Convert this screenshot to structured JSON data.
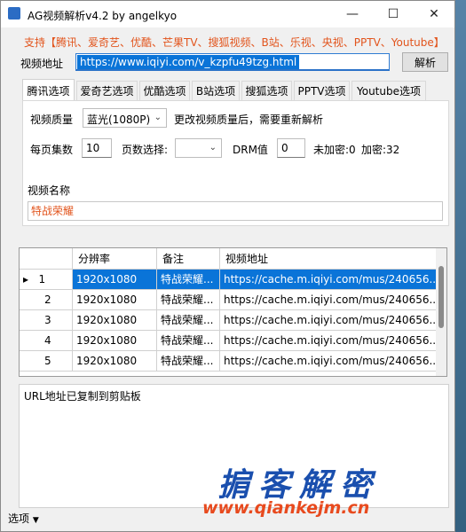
{
  "window": {
    "title": "AG视频解析v4.2 by angelkyo",
    "controls": [
      "minimize-icon",
      "maximize-icon",
      "close-icon"
    ]
  },
  "support_text": "支持【腾讯、爱奇艺、优酷、芒果TV、搜狐视频、B站、乐视、央视、PPTV、Youtube】",
  "url": {
    "label": "视频地址",
    "value": "https://www.iqiyi.com/v_kzpfu49tzg.html"
  },
  "parse_button": "解析",
  "tabs": [
    "腾讯选项",
    "爱奇艺选项",
    "优酷选项",
    "B站选项",
    "搜狐选项",
    "PPTV选项",
    "Youtube选项"
  ],
  "quality": {
    "label": "视频质量",
    "selected": "蓝光(1080P)",
    "hint": "更改视频质量后，需要重新解析"
  },
  "paging": {
    "per_page_label": "每页集数",
    "per_page_value": "10",
    "page_select_label": "页数选择:",
    "page_select_value": "",
    "drm_label": "DRM值",
    "drm_value": "0",
    "unencrypted": "未加密:0",
    "encrypted": "加密:32"
  },
  "video_name": {
    "label": "视频名称",
    "value": "特战荣耀"
  },
  "grid": {
    "columns": [
      "",
      "分辨率",
      "备注",
      "视频地址"
    ],
    "rows": [
      {
        "num": "1",
        "resolution": "1920x1080",
        "note": "特战荣耀...",
        "url": "https://cache.m.iqiyi.com/mus/240656..."
      },
      {
        "num": "2",
        "resolution": "1920x1080",
        "note": "特战荣耀...",
        "url": "https://cache.m.iqiyi.com/mus/240656..."
      },
      {
        "num": "3",
        "resolution": "1920x1080",
        "note": "特战荣耀...",
        "url": "https://cache.m.iqiyi.com/mus/240656..."
      },
      {
        "num": "4",
        "resolution": "1920x1080",
        "note": "特战荣耀...",
        "url": "https://cache.m.iqiyi.com/mus/240656..."
      },
      {
        "num": "5",
        "resolution": "1920x1080",
        "note": "特战荣耀...",
        "url": "https://cache.m.iqiyi.com/mus/240656..."
      }
    ],
    "selected_row": 0
  },
  "status_text": "URL地址已复制到剪贴板",
  "watermark": {
    "text": "掮客解密",
    "url": "www.qiankejm.cn"
  },
  "bottom": {
    "options_label": "选项"
  },
  "colors": {
    "accent": "#0a74d8",
    "support": "#e2541c",
    "watermark_blue": "#1a4fae",
    "watermark_red": "#e84a1e"
  }
}
